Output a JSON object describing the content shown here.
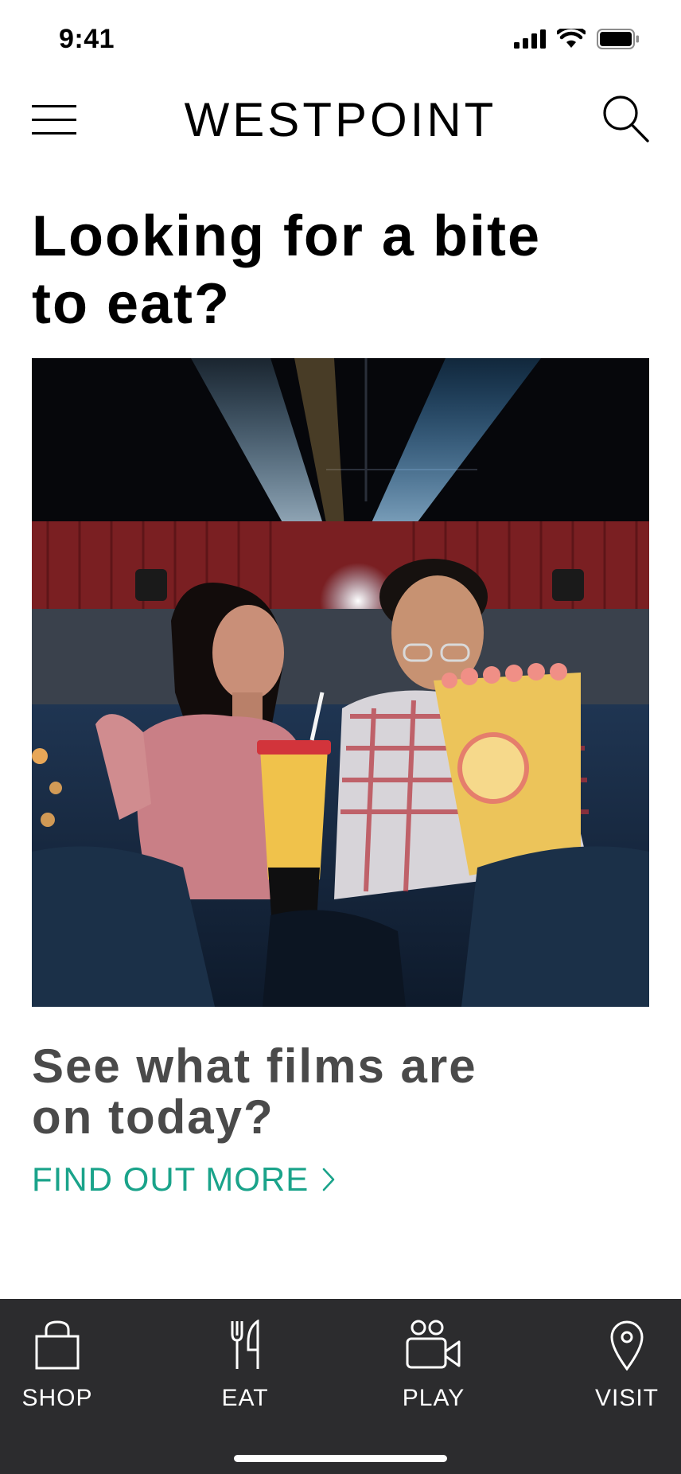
{
  "status_bar": {
    "time": "9:41"
  },
  "header": {
    "brand": "WESTPOINT",
    "menu_icon": "hamburger-menu-icon",
    "search_icon": "search-icon"
  },
  "main": {
    "headline_line1": "Looking for a bite",
    "headline_line2": "to eat?",
    "hero_image": "couple watching a film in a cinema with popcorn and a drink",
    "subhead_line1": "See what films are",
    "subhead_line2": "on today?",
    "cta_label": "FIND OUT MORE",
    "cta_color": "#1aa38a"
  },
  "tabbar": {
    "background": "#2c2c2e",
    "items": [
      {
        "label": "SHOP",
        "icon": "shopping-bag-icon"
      },
      {
        "label": "EAT",
        "icon": "fork-knife-icon"
      },
      {
        "label": "PLAY",
        "icon": "video-camera-icon"
      },
      {
        "label": "VISIT",
        "icon": "location-pin-icon"
      }
    ]
  }
}
